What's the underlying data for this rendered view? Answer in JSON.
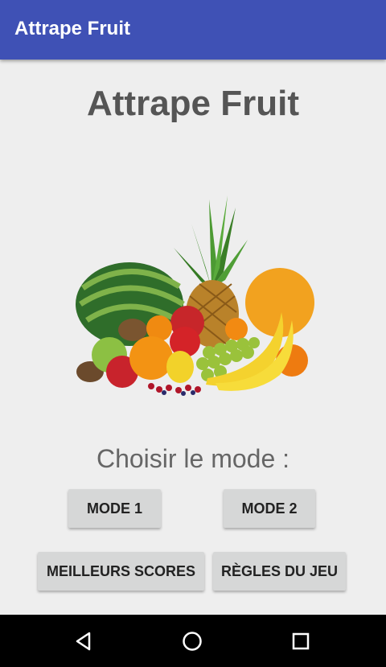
{
  "app_bar": {
    "title": "Attrape Fruit"
  },
  "main": {
    "title": "Attrape Fruit",
    "subtitle": "Choisir le mode :"
  },
  "buttons": {
    "mode1": "MODE 1",
    "mode2": "MODE 2",
    "best_scores": "MEILLEURS SCORES",
    "rules": "RÈGLES DU JEU"
  },
  "nav_bar": {
    "back_icon": "back-triangle-icon",
    "home_icon": "home-circle-icon",
    "recents_icon": "recents-square-icon"
  },
  "colors": {
    "app_bar": "#3f51b5",
    "background": "#eeeeee",
    "button": "#d6d7d7",
    "nav_bar": "#000000"
  }
}
